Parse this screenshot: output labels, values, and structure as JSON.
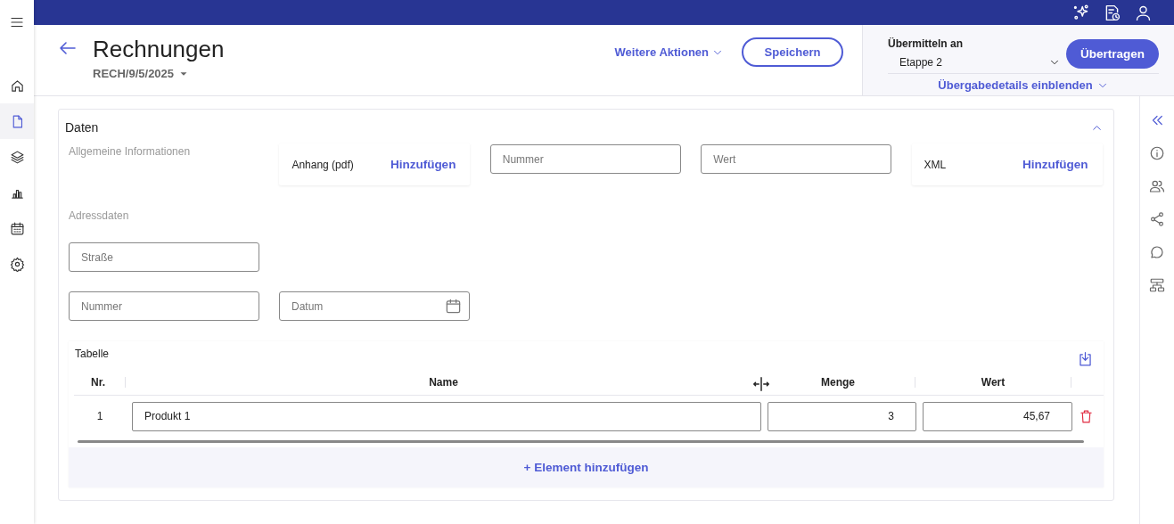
{
  "left_nav": [
    {
      "selected": false
    },
    {
      "selected": true
    },
    {
      "selected": false
    },
    {
      "selected": false
    },
    {
      "selected": false
    },
    {
      "selected": false
    }
  ],
  "header": {
    "title": "Rechnungen",
    "subtitle": "RECH/9/5/2025",
    "more_actions": "Weitere Aktionen",
    "save": "Speichern"
  },
  "transfer": {
    "label": "Übermitteln an",
    "value": "Etappe 2",
    "button": "Übertragen",
    "details": "Übergabedetails einblenden"
  },
  "section": {
    "title": "Daten",
    "expanded": true,
    "general": {
      "label": "Allgemeine Informationen",
      "items": [
        {
          "kind": "attachment",
          "label": "Anhang (pdf)",
          "action": "Hinzufügen"
        },
        {
          "kind": "field",
          "placeholder": "Nummer"
        },
        {
          "kind": "field",
          "placeholder": "Wert"
        },
        {
          "kind": "attachment",
          "label": "XML",
          "action": "Hinzufügen"
        }
      ]
    },
    "address": {
      "label": "Adressdaten",
      "rows": [
        [
          {
            "kind": "field",
            "placeholder": "Straße"
          }
        ],
        [
          {
            "kind": "field",
            "placeholder": "Nummer"
          },
          {
            "kind": "date",
            "placeholder": "Datum"
          }
        ]
      ]
    },
    "table": {
      "title": "Tabelle",
      "columns": [
        "Nr.",
        "Name",
        "Menge",
        "Wert"
      ],
      "rows": [
        {
          "nr": "1",
          "name": "Produkt 1",
          "quantity": "3",
          "value": "45,67"
        }
      ],
      "add": "+ Element hinzufügen"
    }
  }
}
